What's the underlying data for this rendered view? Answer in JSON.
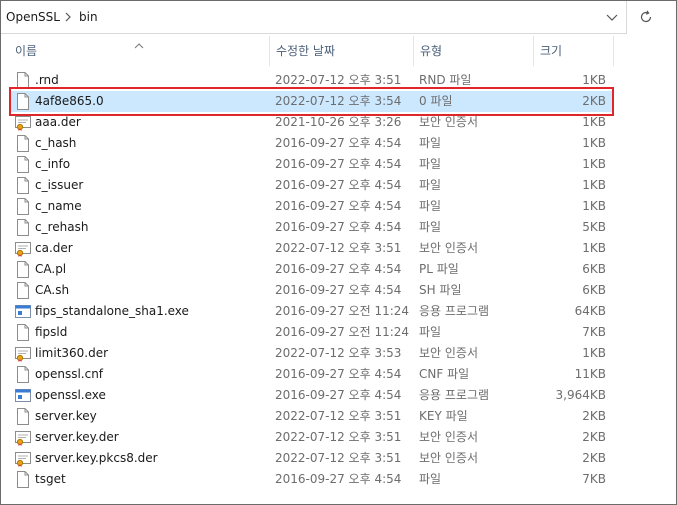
{
  "address_bar": {
    "breadcrumbs": [
      "OpenSSL",
      "bin"
    ]
  },
  "columns": {
    "name": "이름",
    "date": "수정한 날짜",
    "type": "유형",
    "size": "크기"
  },
  "files": [
    {
      "name": ".rnd",
      "date": "2022-07-12 오후 3:51",
      "type": "RND 파일",
      "size": "1KB",
      "icon": "file-icon"
    },
    {
      "name": "4af8e865.0",
      "date": "2022-07-12 오후 3:54",
      "type": "0 파일",
      "size": "2KB",
      "icon": "file-icon",
      "selected": true
    },
    {
      "name": "aaa.der",
      "date": "2021-10-26 오후 3:26",
      "type": "보안 인증서",
      "size": "1KB",
      "icon": "certificate-icon"
    },
    {
      "name": "c_hash",
      "date": "2016-09-27 오후 4:54",
      "type": "파일",
      "size": "1KB",
      "icon": "file-icon"
    },
    {
      "name": "c_info",
      "date": "2016-09-27 오후 4:54",
      "type": "파일",
      "size": "1KB",
      "icon": "file-icon"
    },
    {
      "name": "c_issuer",
      "date": "2016-09-27 오후 4:54",
      "type": "파일",
      "size": "1KB",
      "icon": "file-icon"
    },
    {
      "name": "c_name",
      "date": "2016-09-27 오후 4:54",
      "type": "파일",
      "size": "1KB",
      "icon": "file-icon"
    },
    {
      "name": "c_rehash",
      "date": "2016-09-27 오후 4:54",
      "type": "파일",
      "size": "5KB",
      "icon": "file-icon"
    },
    {
      "name": "ca.der",
      "date": "2022-07-12 오후 3:51",
      "type": "보안 인증서",
      "size": "1KB",
      "icon": "certificate-icon"
    },
    {
      "name": "CA.pl",
      "date": "2016-09-27 오후 4:54",
      "type": "PL 파일",
      "size": "6KB",
      "icon": "file-icon"
    },
    {
      "name": "CA.sh",
      "date": "2016-09-27 오후 4:54",
      "type": "SH 파일",
      "size": "6KB",
      "icon": "file-icon"
    },
    {
      "name": "fips_standalone_sha1.exe",
      "date": "2016-09-27 오전 11:24",
      "type": "응용 프로그램",
      "size": "64KB",
      "icon": "application-icon"
    },
    {
      "name": "fipsld",
      "date": "2016-09-27 오전 11:24",
      "type": "파일",
      "size": "7KB",
      "icon": "file-icon"
    },
    {
      "name": "limit360.der",
      "date": "2022-07-12 오후 3:53",
      "type": "보안 인증서",
      "size": "1KB",
      "icon": "certificate-icon"
    },
    {
      "name": "openssl.cnf",
      "date": "2016-09-27 오후 4:54",
      "type": "CNF 파일",
      "size": "11KB",
      "icon": "file-icon"
    },
    {
      "name": "openssl.exe",
      "date": "2016-09-27 오후 4:54",
      "type": "응용 프로그램",
      "size": "3,964KB",
      "icon": "application-icon"
    },
    {
      "name": "server.key",
      "date": "2022-07-12 오후 3:51",
      "type": "KEY 파일",
      "size": "2KB",
      "icon": "file-icon"
    },
    {
      "name": "server.key.der",
      "date": "2022-07-12 오후 3:51",
      "type": "보안 인증서",
      "size": "2KB",
      "icon": "certificate-icon"
    },
    {
      "name": "server.key.pkcs8.der",
      "date": "2022-07-12 오후 3:51",
      "type": "보안 인증서",
      "size": "2KB",
      "icon": "certificate-icon"
    },
    {
      "name": "tsget",
      "date": "2016-09-27 오후 4:54",
      "type": "파일",
      "size": "7KB",
      "icon": "file-icon"
    }
  ],
  "colors": {
    "selection": "#cce8ff",
    "highlight_border": "#e0252b",
    "header_text": "#4c607a"
  }
}
